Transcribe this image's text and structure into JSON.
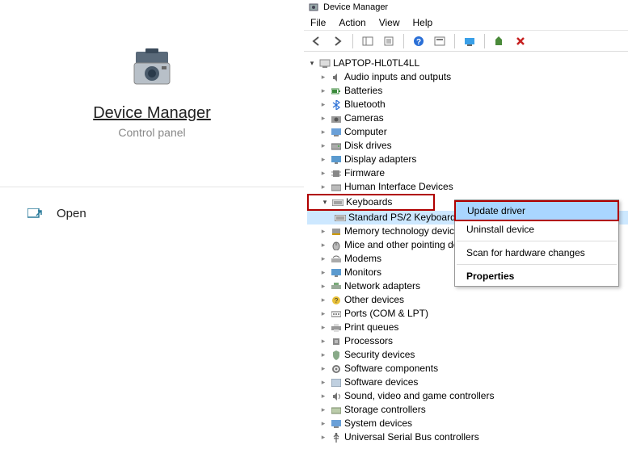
{
  "left": {
    "title": "Device Manager",
    "subtitle": "Control panel",
    "open_label": "Open"
  },
  "titlebar": {
    "title": "Device Manager"
  },
  "menu": {
    "file": "File",
    "action": "Action",
    "view": "View",
    "help": "Help"
  },
  "root_node": "LAPTOP-HL0TL4LL",
  "categories": {
    "audio": "Audio inputs and outputs",
    "batteries": "Batteries",
    "bluetooth": "Bluetooth",
    "cameras": "Cameras",
    "computer": "Computer",
    "disk": "Disk drives",
    "display": "Display adapters",
    "firmware": "Firmware",
    "hid": "Human Interface Devices",
    "keyboards": "Keyboards",
    "keyboard_child": "Standard PS/2 Keyboard",
    "memory": "Memory technology device",
    "mice": "Mice and other pointing de",
    "modems": "Modems",
    "monitors": "Monitors",
    "network": "Network adapters",
    "other": "Other devices",
    "ports": "Ports (COM & LPT)",
    "print": "Print queues",
    "processors": "Processors",
    "security": "Security devices",
    "software": "Software components",
    "swdev": "Software devices",
    "sound": "Sound, video and game controllers",
    "storage": "Storage controllers",
    "system": "System devices",
    "usb": "Universal Serial Bus controllers"
  },
  "context_menu": {
    "update": "Update driver",
    "uninstall": "Uninstall device",
    "scan": "Scan for hardware changes",
    "properties": "Properties"
  }
}
